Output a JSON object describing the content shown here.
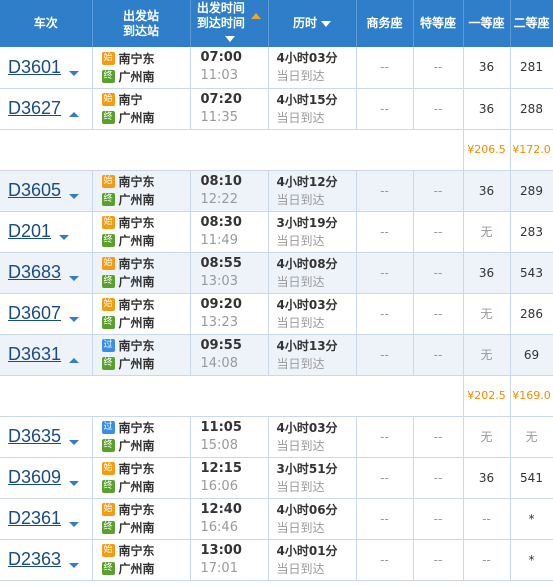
{
  "headers": {
    "train": "车次",
    "station_dep": "出发站",
    "station_arr": "到达站",
    "time_dep": "出发时间",
    "time_arr": "到达时间",
    "duration": "历时",
    "business": "商务座",
    "special": "特等座",
    "first": "一等座",
    "second": "二等座"
  },
  "badges": {
    "start": "始",
    "pass": "过",
    "end": "终"
  },
  "colors": {
    "header_bg": "#2e7ec9",
    "price": "#f08c00",
    "train_link": "#1a4c85",
    "alt_row": "#eef2f9"
  },
  "rows": [
    {
      "kind": "train",
      "code": "D3601",
      "expand": "down",
      "dep_badge": "始",
      "dep_station": "南宁东",
      "arr_badge": "终",
      "arr_station": "广州南",
      "dep_time": "07:00",
      "arr_time": "11:03",
      "duration": "4小时03分",
      "arrive_note": "当日到达",
      "business": "--",
      "special": "--",
      "first": "36",
      "second": "281"
    },
    {
      "kind": "train",
      "code": "D3627",
      "expand": "up",
      "dep_badge": "始",
      "dep_station": "南宁",
      "arr_badge": "终",
      "arr_station": "广州南",
      "dep_time": "07:20",
      "arr_time": "11:35",
      "duration": "4小时15分",
      "arrive_note": "当日到达",
      "business": "--",
      "special": "--",
      "first": "36",
      "second": "288"
    },
    {
      "kind": "price",
      "first": "¥206.5",
      "second": "¥172.0"
    },
    {
      "kind": "train",
      "code": "D3605",
      "expand": "down",
      "dep_badge": "始",
      "dep_station": "南宁东",
      "arr_badge": "终",
      "arr_station": "广州南",
      "dep_time": "08:10",
      "arr_time": "12:22",
      "duration": "4小时12分",
      "arrive_note": "当日到达",
      "business": "--",
      "special": "--",
      "first": "36",
      "second": "289"
    },
    {
      "kind": "train",
      "code": "D201",
      "expand": "down",
      "dep_badge": "始",
      "dep_station": "南宁东",
      "arr_badge": "终",
      "arr_station": "广州南",
      "dep_time": "08:30",
      "arr_time": "11:49",
      "duration": "3小时19分",
      "arrive_note": "当日到达",
      "business": "--",
      "special": "--",
      "first": "无",
      "second": "283"
    },
    {
      "kind": "train",
      "code": "D3683",
      "expand": "down",
      "dep_badge": "始",
      "dep_station": "南宁东",
      "arr_badge": "终",
      "arr_station": "广州南",
      "dep_time": "08:55",
      "arr_time": "13:03",
      "duration": "4小时08分",
      "arrive_note": "当日到达",
      "business": "--",
      "special": "--",
      "first": "36",
      "second": "543"
    },
    {
      "kind": "train",
      "code": "D3607",
      "expand": "down",
      "dep_badge": "始",
      "dep_station": "南宁东",
      "arr_badge": "终",
      "arr_station": "广州南",
      "dep_time": "09:20",
      "arr_time": "13:23",
      "duration": "4小时03分",
      "arrive_note": "当日到达",
      "business": "--",
      "special": "--",
      "first": "无",
      "second": "286"
    },
    {
      "kind": "train",
      "code": "D3631",
      "expand": "up",
      "dep_badge": "过",
      "dep_station": "南宁东",
      "arr_badge": "终",
      "arr_station": "广州南",
      "dep_time": "09:55",
      "arr_time": "14:08",
      "duration": "4小时13分",
      "arrive_note": "当日到达",
      "business": "--",
      "special": "--",
      "first": "无",
      "second": "69"
    },
    {
      "kind": "price",
      "first": "¥202.5",
      "second": "¥169.0"
    },
    {
      "kind": "train",
      "code": "D3635",
      "expand": "down",
      "dep_badge": "过",
      "dep_station": "南宁东",
      "arr_badge": "终",
      "arr_station": "广州南",
      "dep_time": "11:05",
      "arr_time": "15:08",
      "duration": "4小时03分",
      "arrive_note": "当日到达",
      "business": "--",
      "special": "--",
      "first": "无",
      "second": "无"
    },
    {
      "kind": "train",
      "code": "D3609",
      "expand": "down",
      "dep_badge": "始",
      "dep_station": "南宁东",
      "arr_badge": "终",
      "arr_station": "广州南",
      "dep_time": "12:15",
      "arr_time": "16:06",
      "duration": "3小时51分",
      "arrive_note": "当日到达",
      "business": "--",
      "special": "--",
      "first": "36",
      "second": "541"
    },
    {
      "kind": "train",
      "code": "D2361",
      "expand": "down",
      "dep_badge": "始",
      "dep_station": "南宁东",
      "arr_badge": "终",
      "arr_station": "广州南",
      "dep_time": "12:40",
      "arr_time": "16:46",
      "duration": "4小时06分",
      "arrive_note": "当日到达",
      "business": "--",
      "special": "--",
      "first": "--",
      "second": "*"
    },
    {
      "kind": "train",
      "code": "D2363",
      "expand": "down",
      "dep_badge": "始",
      "dep_station": "南宁东",
      "arr_badge": "终",
      "arr_station": "广州南",
      "dep_time": "13:00",
      "arr_time": "17:01",
      "duration": "4小时01分",
      "arrive_note": "当日到达",
      "business": "--",
      "special": "--",
      "first": "--",
      "second": "*"
    }
  ]
}
